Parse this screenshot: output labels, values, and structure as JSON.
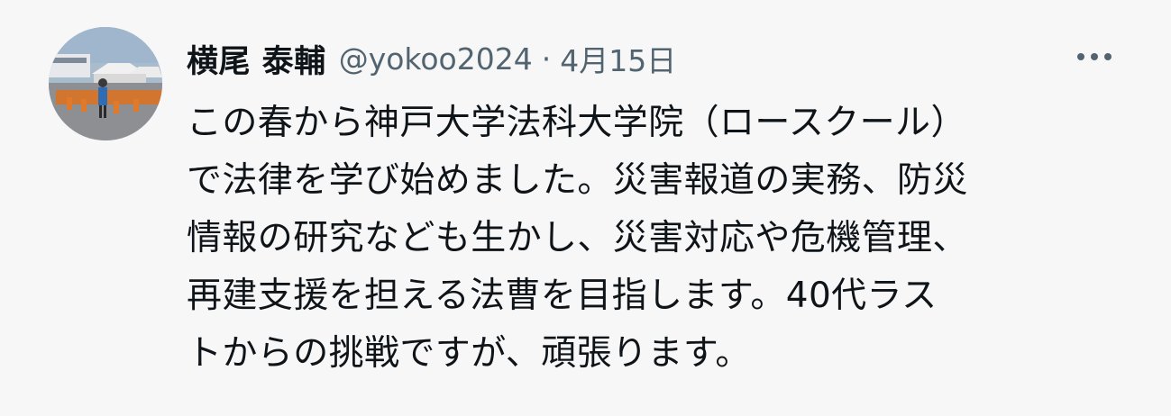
{
  "tweet": {
    "author": {
      "name": "横尾 泰輔",
      "handle": "@yokoo2024"
    },
    "separator": "·",
    "date": "4月15日",
    "avatar": {
      "icon": "profile-photo-running-event"
    },
    "more_icon": "more-horizontal-icon",
    "text": "この春から神戸大学法科大学院（ロースクール）\nで法律を学び始めました。災害報道の実務、防災\n情報の研究なども生かし、災害対応や危機管理、\n再建支援を担える法曹を目指します。40代ラス\nトからの挑戦ですが、頑張ります。"
  },
  "colors": {
    "background": "#f7f7f7",
    "text": "#0f1419",
    "secondary": "#536471"
  }
}
